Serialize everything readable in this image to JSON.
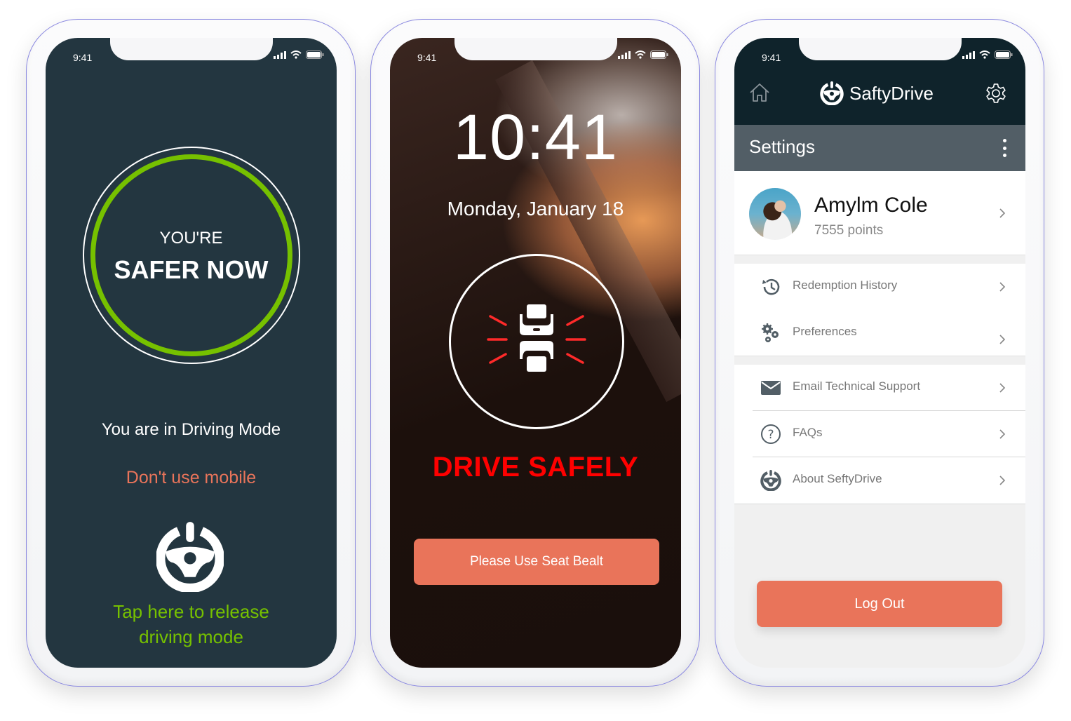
{
  "status_bar": {
    "time": "9:41",
    "icons": [
      "signal-icon",
      "wifi-icon",
      "battery-icon"
    ]
  },
  "screen_driving_mode": {
    "badge_line1": "YOU'RE",
    "badge_line2": "SAFER NOW",
    "mode_text": "You are in Driving Mode",
    "warning_text": "Don't use mobile",
    "release_icon": "steering-wheel-power-icon",
    "release_text_line1": "Tap here to release",
    "release_text_line2": "driving mode",
    "colors": {
      "background": "#233640",
      "ring": "#76c100",
      "warning": "#e9745a",
      "release": "#76c100"
    }
  },
  "screen_lock": {
    "clock": "10:41",
    "date": "Monday, January 18",
    "icon": "seat-belt-alert-icon",
    "headline": "DRIVE SAFELY",
    "button_label": "Please Use Seat Bealt",
    "colors": {
      "headline": "#ff0000",
      "button": "#e9745a"
    }
  },
  "screen_settings": {
    "app_name": "SaftyDrive",
    "header_icons": {
      "left": "home-icon",
      "logo": "steering-wheel-icon",
      "right": "gear-icon"
    },
    "section_title": "Settings",
    "more_icon": "kebab-menu-icon",
    "profile": {
      "name": "Amylm Cole",
      "points": "7555 points"
    },
    "groups": [
      {
        "items": [
          {
            "icon": "history-icon",
            "label": "Redemption History"
          },
          {
            "icon": "gears-icon",
            "label": "Preferences"
          }
        ]
      },
      {
        "items": [
          {
            "icon": "envelope-icon",
            "label": "Email Technical Support"
          },
          {
            "icon": "question-circle-icon",
            "label": "FAQs"
          },
          {
            "icon": "steering-wheel-icon",
            "label": "About SeftyDrive"
          }
        ]
      }
    ],
    "logout_label": "Log Out",
    "colors": {
      "header": "#0f232b",
      "section_bar": "#525e66",
      "button": "#e9745a",
      "icon": "#525e66"
    }
  }
}
